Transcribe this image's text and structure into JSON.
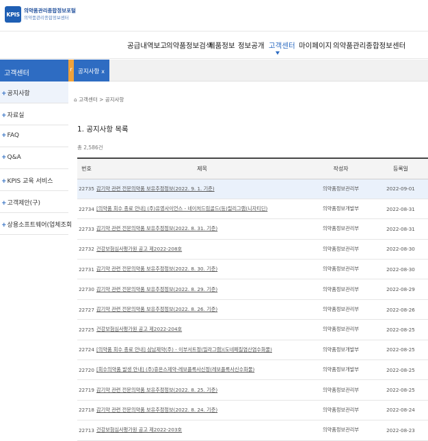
{
  "logo": {
    "mark": "KPIS",
    "line1": "의약품관리종합정보포털",
    "line2": "의약품관리종합정보센터"
  },
  "gnb": [
    {
      "label": "공급내역보고",
      "active": false
    },
    {
      "label": "의약품정보검색",
      "active": false
    },
    {
      "label": "제품정보",
      "active": false
    },
    {
      "label": "정보공개",
      "active": false
    },
    {
      "label": "고객센터",
      "active": true
    },
    {
      "label": "마이페이지",
      "active": false
    },
    {
      "label": "의약품관리종합정보센터",
      "active": false
    }
  ],
  "sidebar": {
    "title": "고객센터",
    "items": [
      {
        "label": "공지사항",
        "active": true
      },
      {
        "label": "자료실",
        "active": false
      },
      {
        "label": "FAQ",
        "active": false
      },
      {
        "label": "Q&A",
        "active": false
      },
      {
        "label": "KPIS 교육 서비스",
        "active": false
      },
      {
        "label": "고객제안(구)",
        "active": false
      },
      {
        "label": "상용소프트웨어(업체조회",
        "active": false
      }
    ],
    "plus_glyph": "+"
  },
  "tabs": {
    "handle": "r",
    "active_tab": "공지사항",
    "close_glyph": "x"
  },
  "breadcrumb": {
    "home_icon": "⌂",
    "path": "고객센터 > 공지사항"
  },
  "section_title": "1. 공지사항 목록",
  "count_text": "총 2,586건",
  "table": {
    "headers": {
      "no": "번호",
      "title": "제목",
      "author": "작성자",
      "date": "등록일"
    },
    "rows": [
      {
        "no": "22735",
        "title": "감기약 관련 전문의약품 보유추정정보(2022. 9. 1. 기준)",
        "author": "의약품정보관리부",
        "date": "2022-09-01",
        "highlight": true
      },
      {
        "no": "22734",
        "title": "[의약품 회수 종료 안내] (주)유영사이언스 - 네이처드림골드(등)릴리그램(니자티딘)",
        "author": "의약품정보개발부",
        "date": "2022-08-31",
        "highlight": false
      },
      {
        "no": "22733",
        "title": "감기약 관련 전문의약품 보유추정정보(2022. 8. 31. 기준)",
        "author": "의약품정보관리부",
        "date": "2022-08-31",
        "highlight": false
      },
      {
        "no": "22732",
        "title": "건강보험심사평가원 공고 제2022-208호",
        "author": "의약품정보관리부",
        "date": "2022-08-30",
        "highlight": false
      },
      {
        "no": "22731",
        "title": "감기약 관련 전문의약품 보유추정정보(2022. 8. 30. 기준)",
        "author": "의약품정보관리부",
        "date": "2022-08-30",
        "highlight": false
      },
      {
        "no": "22730",
        "title": "감기약 관련 전문의약품 보유추정정보(2022. 8. 29. 기준)",
        "author": "의약품정보관리부",
        "date": "2022-08-29",
        "highlight": false
      },
      {
        "no": "22727",
        "title": "감기약 관련 전문의약품 보유추정정보(2022. 8. 26. 기준)",
        "author": "의약품정보관리부",
        "date": "2022-08-26",
        "highlight": false
      },
      {
        "no": "22725",
        "title": "건강보험심사평가원 공고 제2022-204호",
        "author": "의약품정보관리부",
        "date": "2022-08-25",
        "highlight": false
      },
      {
        "no": "22724",
        "title": "[의약품 회수 종료 안내] 삼남제약(주) - 이부서트정(밀라그램)(도네페질염산염수화물)",
        "author": "의약품정보개발부",
        "date": "2022-08-25",
        "highlight": false
      },
      {
        "no": "22720",
        "title": "[회수의약품 발생 안내] (주)휴온스제약-레보플록사신정(레보플록사신수화물)",
        "author": "의약품정보개발부",
        "date": "2022-08-25",
        "highlight": false
      },
      {
        "no": "22719",
        "title": "감기약 관련 전문의약품 보유추정정보(2022. 8. 25. 기준)",
        "author": "의약품정보관리부",
        "date": "2022-08-25",
        "highlight": false
      },
      {
        "no": "22718",
        "title": "감기약 관련 전문의약품 보유추정정보(2022. 8. 24. 기준)",
        "author": "의약품정보관리부",
        "date": "2022-08-24",
        "highlight": false
      },
      {
        "no": "22713",
        "title": "건강보험심사평가원 공고 제2022-203호",
        "author": "의약품정보관리부",
        "date": "2022-08-23",
        "highlight": false
      }
    ]
  },
  "colors": {
    "accent": "#2e6cc2",
    "tab_handle": "#f0a23a",
    "row_highlight": "#eaf1fb"
  }
}
